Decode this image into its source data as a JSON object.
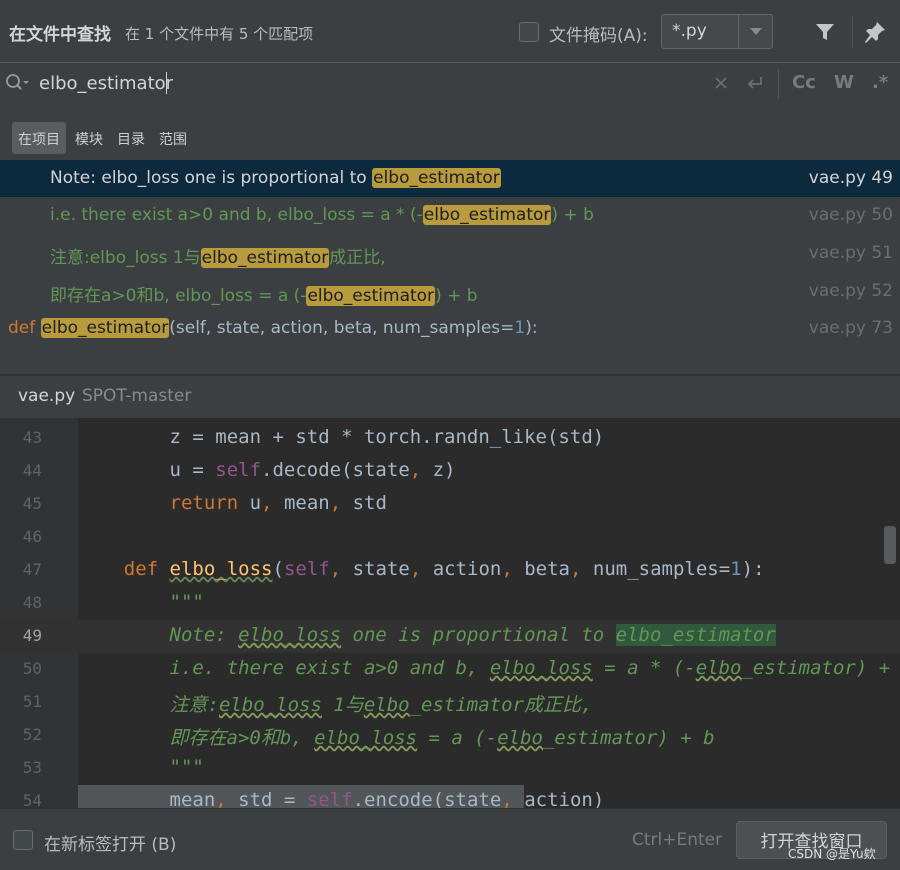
{
  "header": {
    "title": "在文件中查找",
    "subtitle": "在 1 个文件中有 5 个匹配项",
    "file_mask_label": "文件掩码(A):",
    "file_mask_value": "*.py",
    "icons": [
      "filter-icon",
      "pin-icon"
    ]
  },
  "search": {
    "query": "elbo_estimator",
    "options": [
      "Cc",
      "W",
      ".*"
    ]
  },
  "scope_tabs": [
    {
      "label": "在项目",
      "active": true
    },
    {
      "label": "模块",
      "active": false
    },
    {
      "label": "目录",
      "active": false
    },
    {
      "label": "范围",
      "active": false
    }
  ],
  "results": [
    {
      "pre": "Note: elbo_loss one is proportional to ",
      "match": "elbo_estimator",
      "post": "",
      "file": "vae.py 49",
      "selected": true
    },
    {
      "pre": "i.e. there exist a>0 and b, elbo_loss = a * (-",
      "match": "elbo_estimator",
      "post": ") + b",
      "file": "vae.py 50",
      "selected": false
    },
    {
      "pre": "注意:elbo_loss 1与",
      "match": "elbo_estimator",
      "post": "成正比,",
      "file": "vae.py 51",
      "selected": false
    },
    {
      "pre": "即存在a>0和b, elbo_loss = a (-",
      "match": "elbo_estimator",
      "post": ") + b",
      "file": "vae.py 52",
      "selected": false
    },
    {
      "kw": "def ",
      "match": "elbo_estimator",
      "post_a": "(self, state, action, beta, num_samples=",
      "num": "1",
      "post_b": "):",
      "file": "vae.py 73",
      "selected": false
    }
  ],
  "preview": {
    "file": "vae.py",
    "project": "SPOT-master"
  },
  "editor": {
    "line_numbers": [
      "43",
      "44",
      "45",
      "46",
      "47",
      "48",
      "49",
      "50",
      "51",
      "52",
      "53",
      "54"
    ],
    "current_line": "49"
  },
  "footer": {
    "open_in_tab_label": "在新标签打开 (B)",
    "shortcut": "Ctrl+Enter",
    "open_button": "打开查找窗口",
    "watermark": "CSDN @是Yu欸"
  },
  "colors": {
    "background": "#3c3f41",
    "editor_background": "#2b2b2b",
    "selected_row": "#0d293e",
    "match_highlight": "#b89b3c",
    "docstring": "#629755",
    "keyword": "#cc7832",
    "function": "#ffc66d"
  }
}
